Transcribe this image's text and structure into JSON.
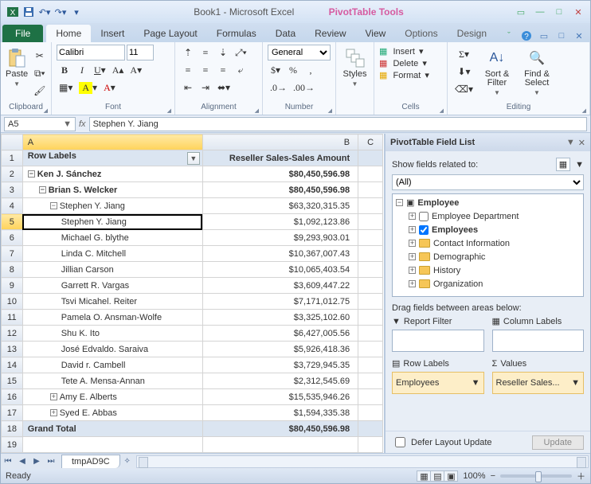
{
  "title": "Book1 - Microsoft Excel",
  "context_title": "PivotTable Tools",
  "tabs": {
    "file": "File",
    "home": "Home",
    "insert": "Insert",
    "pagelayout": "Page Layout",
    "formulas": "Formulas",
    "data": "Data",
    "review": "Review",
    "view": "View",
    "options": "Options",
    "design": "Design"
  },
  "groups": {
    "clipboard": "Clipboard",
    "font": "Font",
    "alignment": "Alignment",
    "number": "Number",
    "styles": "Styles",
    "cells": "Cells",
    "editing": "Editing"
  },
  "font": {
    "name": "Calibri",
    "size": "11"
  },
  "number_format": "General",
  "clipboard_paste": "Paste",
  "styles_btn": "Styles",
  "cells": {
    "insert": "Insert",
    "delete": "Delete",
    "format": "Format"
  },
  "editing": {
    "sort": "Sort & Filter",
    "find": "Find & Select"
  },
  "namebox": "A5",
  "fx_label": "fx",
  "fx_value": "Stephen Y. Jiang",
  "columns": {
    "A": "A",
    "B": "B",
    "C": "C"
  },
  "rows": [
    {
      "n": "1",
      "a": "Row Labels",
      "b": "Reseller Sales-Sales Amount",
      "bold": true,
      "shade": true,
      "drop": true
    },
    {
      "n": "2",
      "a": "Ken J. Sánchez",
      "b": "$80,450,596.98",
      "bold": true,
      "exp": "-",
      "ind": 0
    },
    {
      "n": "3",
      "a": "Brian S. Welcker",
      "b": "$80,450,596.98",
      "bold": true,
      "exp": "-",
      "ind": 1
    },
    {
      "n": "4",
      "a": "Stephen Y. Jiang",
      "b": "$63,320,315.35",
      "exp": "-",
      "ind": 2
    },
    {
      "n": "5",
      "a": "Stephen Y. Jiang",
      "b": "$1,092,123.86",
      "ind": 3,
      "sel": true
    },
    {
      "n": "6",
      "a": "Michael G. blythe",
      "b": "$9,293,903.01",
      "ind": 3
    },
    {
      "n": "7",
      "a": "Linda C. Mitchell",
      "b": "$10,367,007.43",
      "ind": 3
    },
    {
      "n": "8",
      "a": "Jillian Carson",
      "b": "$10,065,403.54",
      "ind": 3
    },
    {
      "n": "9",
      "a": "Garrett R. Vargas",
      "b": "$3,609,447.22",
      "ind": 3
    },
    {
      "n": "10",
      "a": "Tsvi Micahel. Reiter",
      "b": "$7,171,012.75",
      "ind": 3
    },
    {
      "n": "11",
      "a": "Pamela O. Ansman-Wolfe",
      "b": "$3,325,102.60",
      "ind": 3
    },
    {
      "n": "12",
      "a": "Shu K. Ito",
      "b": "$6,427,005.56",
      "ind": 3
    },
    {
      "n": "13",
      "a": "José Edvaldo. Saraiva",
      "b": "$5,926,418.36",
      "ind": 3
    },
    {
      "n": "14",
      "a": "David r. Cambell",
      "b": "$3,729,945.35",
      "ind": 3
    },
    {
      "n": "15",
      "a": "Tete A. Mensa-Annan",
      "b": "$2,312,545.69",
      "ind": 3
    },
    {
      "n": "16",
      "a": "Amy E. Alberts",
      "b": "$15,535,946.26",
      "exp": "+",
      "ind": 2
    },
    {
      "n": "17",
      "a": "Syed E. Abbas",
      "b": "$1,594,335.38",
      "exp": "+",
      "ind": 2
    },
    {
      "n": "18",
      "a": "Grand Total",
      "b": "$80,450,596.98",
      "bold": true,
      "shade": true
    },
    {
      "n": "19",
      "a": "",
      "b": ""
    }
  ],
  "pane": {
    "title": "PivotTable Field List",
    "show_label": "Show fields related to:",
    "show_value": "(All)",
    "tree": {
      "root": "Employee",
      "nodes": [
        {
          "label": "Employee Department",
          "checked": false,
          "type": "check"
        },
        {
          "label": "Employees",
          "checked": true,
          "type": "check"
        },
        {
          "label": "Contact Information",
          "type": "folder"
        },
        {
          "label": "Demographic",
          "type": "folder"
        },
        {
          "label": "History",
          "type": "folder"
        },
        {
          "label": "Organization",
          "type": "folder"
        }
      ]
    },
    "drag_label": "Drag fields between areas below:",
    "areas": {
      "filter": "Report Filter",
      "columns": "Column Labels",
      "rows": "Row Labels",
      "values": "Values"
    },
    "row_field": "Employees",
    "value_field": "Reseller Sales...",
    "defer": "Defer Layout Update",
    "update": "Update"
  },
  "sheet_tab": "tmpAD9C",
  "status_ready": "Ready",
  "zoom": "100%"
}
